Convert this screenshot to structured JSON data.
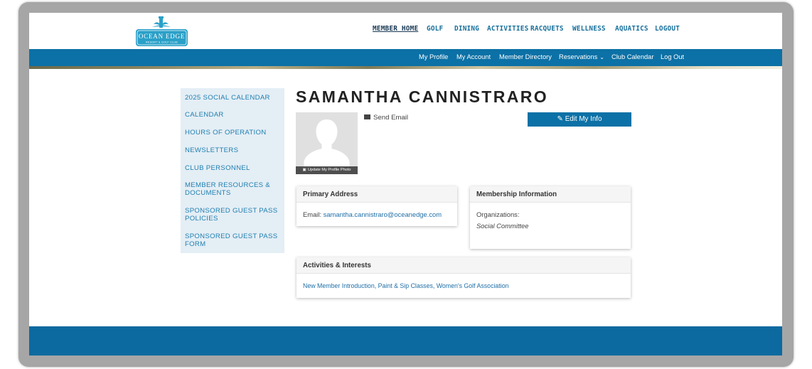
{
  "brand": {
    "logo_name": "OCEAN EDGE",
    "logo_sub": "RESORT & GOLF CLUB",
    "color": "#2aa0c8"
  },
  "main_nav": [
    "MEMBER HOME",
    "GOLF",
    "DINING",
    "ACTIVITIES",
    "RACQUETS",
    "WELLNESS",
    "AQUATICS",
    "LOGOUT"
  ],
  "sub_nav": [
    "My Profile",
    "My Account",
    "Member Directory",
    "Reservations",
    "Club Calendar",
    "Log Out"
  ],
  "sidebar": [
    "2025 SOCIAL CALENDAR",
    "CALENDAR",
    "HOURS OF OPERATION",
    "NEWSLETTERS",
    "CLUB PERSONNEL",
    "MEMBER RESOURCES & DOCUMENTS",
    "SPONSORED GUEST PASS POLICIES",
    "SPONSORED GUEST PASS FORM"
  ],
  "profile": {
    "name": "SAMANTHA CANNISTRARO",
    "photo_caption": "Update My Profile Photo",
    "send_email": "Send Email",
    "edit_button": "Edit My Info"
  },
  "primary_address": {
    "title": "Primary Address",
    "email_label": "Email:",
    "email": "samantha.cannistraro@oceanedge.com"
  },
  "membership": {
    "title": "Membership Information",
    "org_label": "Organizations:",
    "org_value": "Social Committee"
  },
  "activities": {
    "title": "Activities & Interests",
    "value": "New Member Introduction, Paint & Sip Classes, Women's Golf Association"
  },
  "colors": {
    "primary": "#0c71a6",
    "link": "#1f7fb0",
    "sidebar_bg": "#e4eef5"
  }
}
